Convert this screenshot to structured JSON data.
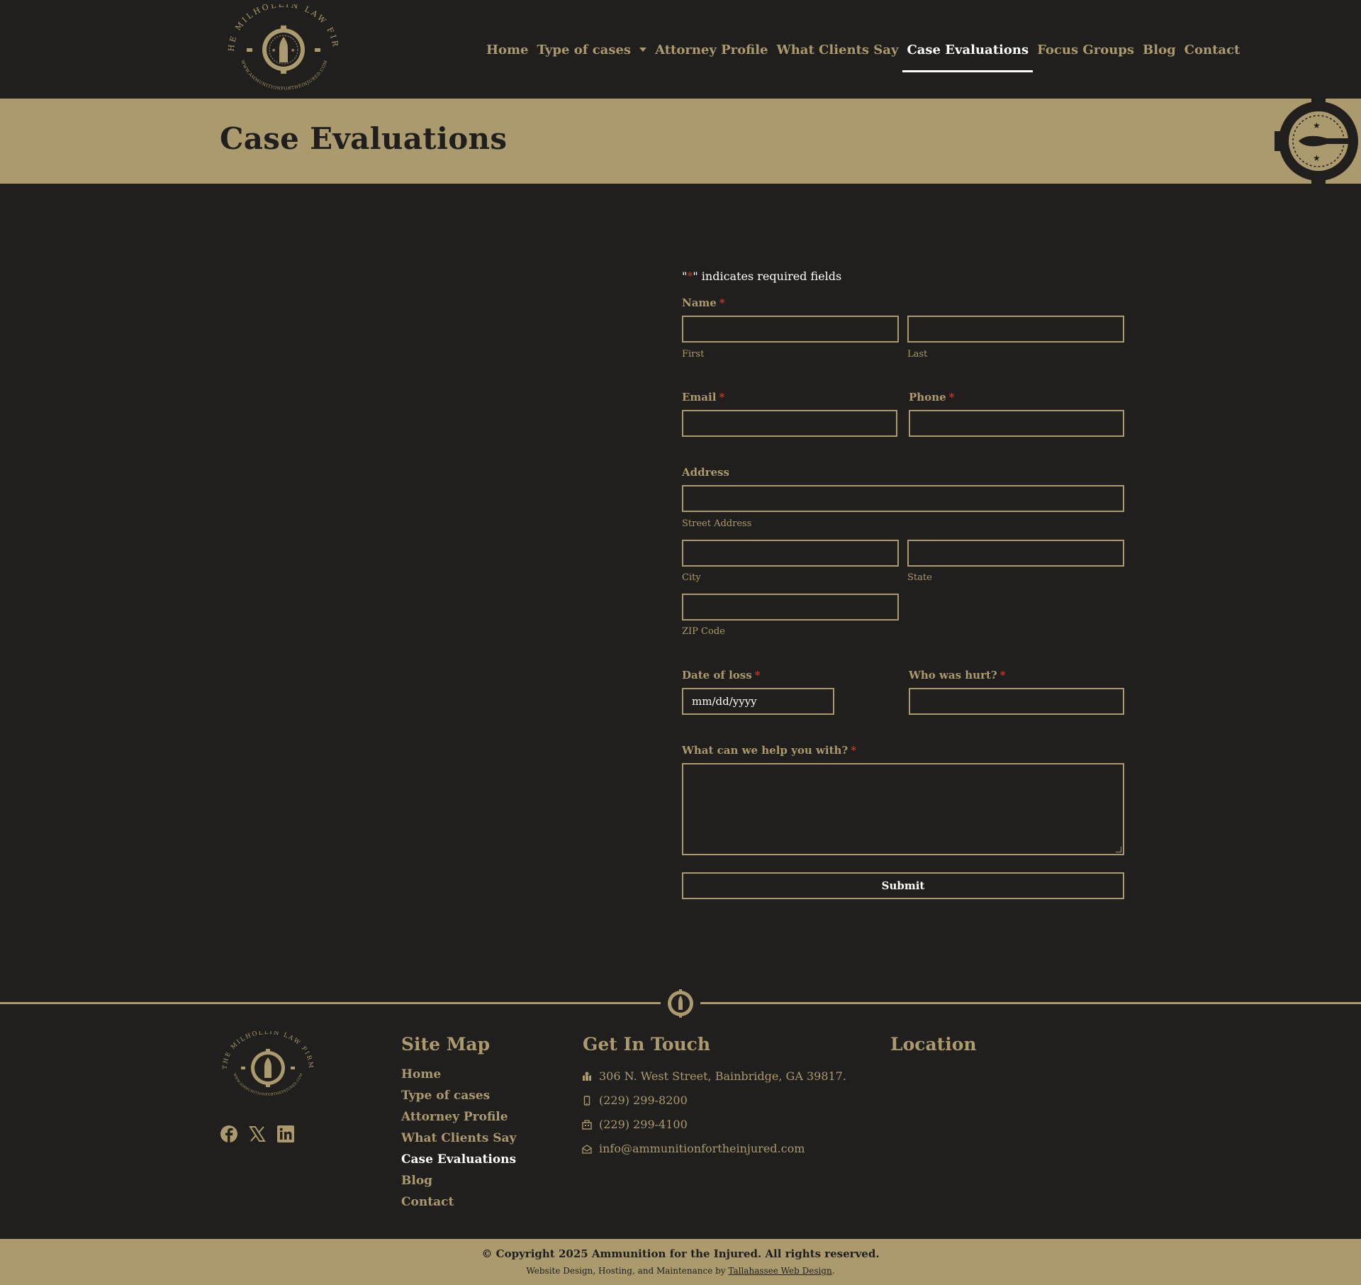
{
  "header": {
    "logo_text": "THE MILHOLLIN LAW FIRM",
    "logo_url_text": "WWW.AMMUNITIONFORTHEINJURED.COM",
    "nav": [
      {
        "label": "Home"
      },
      {
        "label": "Type of cases",
        "has_dropdown": true
      },
      {
        "label": "Attorney Profile"
      },
      {
        "label": "What Clients Say"
      },
      {
        "label": "Case Evaluations",
        "active": true
      },
      {
        "label": "Focus Groups"
      },
      {
        "label": "Blog"
      },
      {
        "label": "Contact"
      }
    ]
  },
  "page": {
    "title": "Case Evaluations"
  },
  "form": {
    "required_note_prefix": "\"",
    "required_note_star": "*",
    "required_note_suffix": "\" indicates required fields",
    "name_label": "Name",
    "first_sublabel": "First",
    "last_sublabel": "Last",
    "email_label": "Email",
    "phone_label": "Phone",
    "address_label": "Address",
    "street_sublabel": "Street Address",
    "city_sublabel": "City",
    "state_sublabel": "State",
    "zip_sublabel": "ZIP Code",
    "date_label": "Date of loss",
    "date_placeholder": "mm/dd/yyyy",
    "who_hurt_label": "Who was hurt?",
    "help_label": "What can we help you with?",
    "required_star": "*",
    "submit_label": "Submit"
  },
  "footer": {
    "sitemap_heading": "Site Map",
    "sitemap_links": [
      "Home",
      "Type of cases",
      "Attorney Profile",
      "What Clients Say",
      "Case Evaluations",
      "Blog",
      "Contact"
    ],
    "contact_heading": "Get In Touch",
    "address": "306 N. West Street, Bainbridge, GA 39817.",
    "phone": "(229) 299-8200",
    "fax": "(229) 299-4100",
    "email": "info@ammunitionfortheinjured.com",
    "location_heading": "Location",
    "social_icons": [
      "facebook-icon",
      "x-twitter-icon",
      "linkedin-icon"
    ],
    "copyright": "© Copyright 2025 Ammunition for the Injured. All rights reserved.",
    "credit_prefix": "Website Design, Hosting, and Maintenance by ",
    "credit_link": "Tallahassee Web Design",
    "credit_suffix": "."
  },
  "colors": {
    "background": "#201f1d",
    "accent": "#ab9a6e",
    "required": "#c0392b",
    "active": "#ffffff"
  }
}
